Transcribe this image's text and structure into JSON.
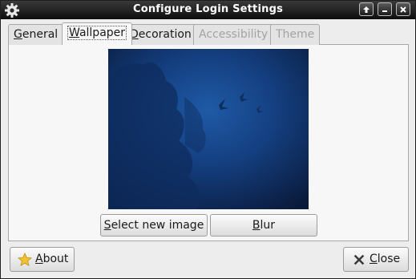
{
  "window": {
    "title": "Configure Login Settings",
    "controls": [
      "up-arrow-icon",
      "minimize-icon",
      "close-icon"
    ]
  },
  "tabs": [
    {
      "label": "General",
      "mnemonic": "G",
      "rest": "eneral",
      "state": "normal"
    },
    {
      "label": "Wallpaper",
      "mnemonic": "W",
      "rest": "allpaper",
      "state": "active"
    },
    {
      "label": "Decoration",
      "mnemonic": "D",
      "rest": "ecoration",
      "state": "normal"
    },
    {
      "label": "Accessibility",
      "mnemonic": "",
      "rest": "Accessibility",
      "state": "disabled"
    },
    {
      "label": "Theme",
      "mnemonic": "",
      "rest": "Theme",
      "state": "disabled"
    }
  ],
  "wallpaper": {
    "description_icon": "wallpaper-preview-image",
    "colors": {
      "dark": "#0a1a3a",
      "mid": "#123a78",
      "light": "#1e5aa8"
    }
  },
  "actions": {
    "select_label": "Select new image",
    "select_mnemonic": "S",
    "select_rest": "elect new image",
    "blur_label": "Blur",
    "blur_mnemonic": "B",
    "blur_rest": "lur"
  },
  "footer": {
    "about_label": "About",
    "about_mnemonic": "A",
    "about_rest": "bout",
    "about_icon": "star-icon",
    "close_label": "Close",
    "close_mnemonic": "C",
    "close_rest": "lose",
    "close_icon": "close-x-icon"
  }
}
